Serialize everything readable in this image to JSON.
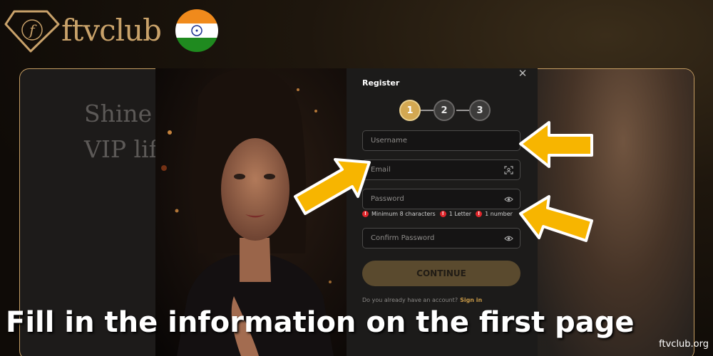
{
  "brand": {
    "name": "ftvclub",
    "mark_letter": "f",
    "flag": "india-flag",
    "color": "#c9a26a"
  },
  "background": {
    "headline": [
      "Shine",
      "VIP lif"
    ]
  },
  "register": {
    "title": "Register",
    "steps": [
      {
        "label": "1",
        "state": "active"
      },
      {
        "label": "2",
        "state": "idle"
      },
      {
        "label": "3",
        "state": "idle"
      }
    ],
    "fields": {
      "username": {
        "placeholder": "Username",
        "value": ""
      },
      "email": {
        "placeholder": "Email",
        "value": "",
        "icon": "scan-icon"
      },
      "password": {
        "placeholder": "Password",
        "value": "",
        "icon": "eye-icon"
      },
      "confirm_password": {
        "placeholder": "Confirm Password",
        "value": "",
        "icon": "eye-icon"
      }
    },
    "password_hints": [
      "Minimum 8 characters",
      "1 Letter",
      "1 number"
    ],
    "continue_label": "CONTINUE",
    "already_text": "Do you already have an account?",
    "signin_label": "Sign in",
    "accent": "#d3a852",
    "error_color": "#e0262b"
  },
  "caption": "Fill in the information on the first page",
  "watermark": "ftvclub.org",
  "arrow_color": "#f7b500"
}
